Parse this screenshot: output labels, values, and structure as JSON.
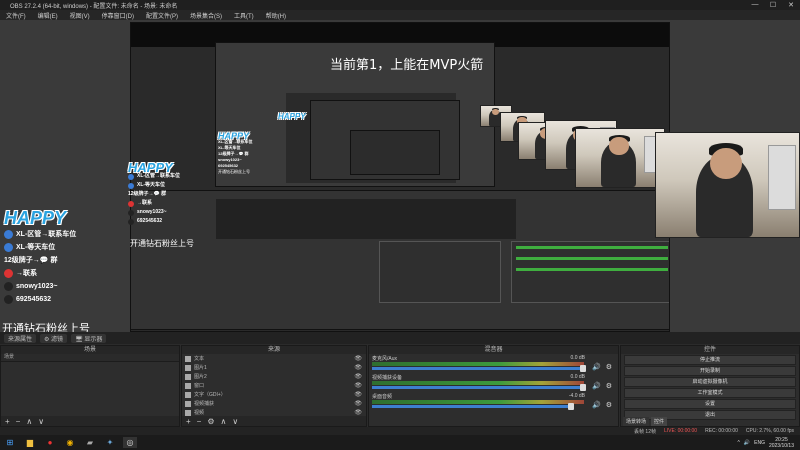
{
  "window": {
    "title": "OBS 27.2.4 (64-bit, windows) - 配置文件: 未命名 - 场景: 未命名",
    "controls": [
      "—",
      "☐",
      "✕"
    ]
  },
  "menu": [
    "文件(F)",
    "编辑(E)",
    "视图(V)",
    "停靠窗口(D)",
    "配置文件(P)",
    "场景集合(S)",
    "工具(T)",
    "帮助(H)"
  ],
  "preview": {
    "overlay_text": "当前第1，上能在MVP火箭",
    "sign": {
      "logo": "HAPPY",
      "lines": [
        "XL-区管→联系车位",
        "XL-等天车位",
        "12级牌子→💬 群",
        "→联系",
        "snowy1023~",
        "692545632"
      ],
      "bottom": "开通钻石粉丝上号"
    }
  },
  "panel_tabs": [
    "来源属性",
    "⚙ 滤镜",
    "🖥 显示器"
  ],
  "scenes": {
    "title": "场景",
    "sub": "场景",
    "footer": [
      "+",
      "−",
      "∧",
      "∨"
    ]
  },
  "sources": {
    "title": "来源",
    "items": [
      "文本",
      "图片1",
      "图片2",
      "窗口",
      "文字（GDI+）",
      "视频捕获",
      "视频"
    ],
    "footer": [
      "+",
      "−",
      "⚙",
      "∧",
      "∨"
    ]
  },
  "mixer": {
    "title": "混音器",
    "channels": [
      {
        "name": "麦克风/Aux",
        "value": "0.0 dB"
      },
      {
        "name": "视频捕获设备",
        "value": "0.0 dB"
      },
      {
        "name": "桌面音频",
        "value": "-4.0 dB"
      }
    ]
  },
  "controls": {
    "title": "控件",
    "buttons": [
      "停止推流",
      "开始录制",
      "启动虚拟摄像机",
      "工作室模式",
      "设置",
      "退出"
    ],
    "tabs": [
      "场景转场",
      "控件"
    ]
  },
  "status": {
    "live": "LIVE: 00:00:00",
    "rec": "REC: 00:00:00",
    "cpu": "CPU: 2.7%, 60.00 fps",
    "dropped": "丢帧 12帧"
  },
  "taskbar": {
    "time": "20:25",
    "date": "2023/10/13",
    "lang": "ENG"
  }
}
